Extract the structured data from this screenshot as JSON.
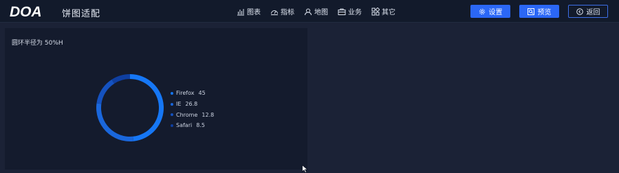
{
  "header": {
    "logo_text": "DOA",
    "app_title": "饼图适配",
    "nav": [
      {
        "label": "图表",
        "icon": "bar-chart-icon"
      },
      {
        "label": "指标",
        "icon": "gauge-icon"
      },
      {
        "label": "地图",
        "icon": "map-pin-icon"
      },
      {
        "label": "业务",
        "icon": "briefcase-icon"
      },
      {
        "label": "其它",
        "icon": "apps-icon"
      }
    ],
    "buttons": {
      "settings": {
        "label": "设置",
        "icon": "gear-icon"
      },
      "preview": {
        "label": "预览",
        "icon": "preview-icon"
      },
      "back": {
        "label": "返回",
        "icon": "back-arrow-icon"
      }
    }
  },
  "panel": {
    "title": "圆环半径为 50%H"
  },
  "chart_data": {
    "type": "pie",
    "variant": "donut",
    "categories": [
      "Firefox",
      "IE",
      "Chrome",
      "Safari"
    ],
    "values": [
      45,
      26.8,
      12.8,
      8.5
    ],
    "value_labels": [
      "45",
      "26.8",
      "12.8",
      "8.5"
    ],
    "colors": [
      "#1677f5",
      "#1a67dc",
      "#1552c0",
      "#0f3fa1"
    ],
    "legend_position": "right"
  }
}
